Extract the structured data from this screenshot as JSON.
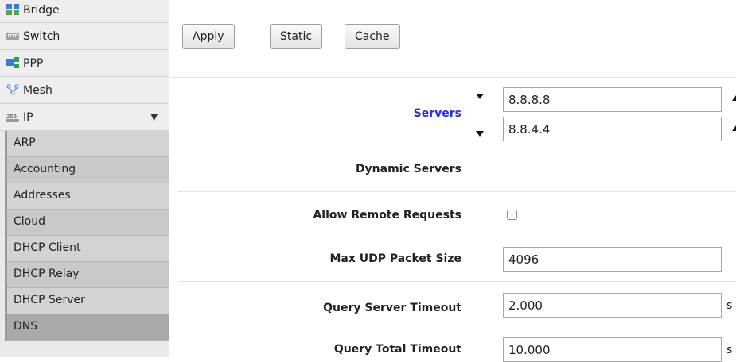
{
  "sidebar": {
    "items": [
      {
        "label": "Bridge",
        "icon": "bridge-icon"
      },
      {
        "label": "Switch",
        "icon": "switch-icon"
      },
      {
        "label": "PPP",
        "icon": "ppp-icon"
      },
      {
        "label": "Mesh",
        "icon": "mesh-icon"
      },
      {
        "label": "IP",
        "icon": "ip-icon",
        "expanded": true
      }
    ],
    "submenu": [
      {
        "label": "ARP"
      },
      {
        "label": "Accounting"
      },
      {
        "label": "Addresses"
      },
      {
        "label": "Cloud"
      },
      {
        "label": "DHCP Client"
      },
      {
        "label": "DHCP Relay"
      },
      {
        "label": "DHCP Server"
      },
      {
        "label": "DNS",
        "active": true
      }
    ]
  },
  "toolbar": {
    "apply_label": "Apply",
    "static_label": "Static",
    "cache_label": "Cache"
  },
  "form": {
    "servers_label": "Servers",
    "servers": [
      "8.8.8.8",
      "8.8.4.4"
    ],
    "dynamic_servers_label": "Dynamic Servers",
    "allow_remote_label": "Allow Remote Requests",
    "allow_remote_checked": false,
    "max_udp_label": "Max UDP Packet Size",
    "max_udp_value": "4096",
    "query_server_timeout_label": "Query Server Timeout",
    "query_server_timeout_value": "2.000",
    "query_server_timeout_unit": "s",
    "query_total_timeout_label": "Query Total Timeout",
    "query_total_timeout_value": "10.000",
    "query_total_timeout_unit": "s"
  },
  "colors": {
    "accent_label": "#2d2de0",
    "sidebar_bg": "#e9e9e9",
    "submenu_bg": "#d3d3d3"
  }
}
